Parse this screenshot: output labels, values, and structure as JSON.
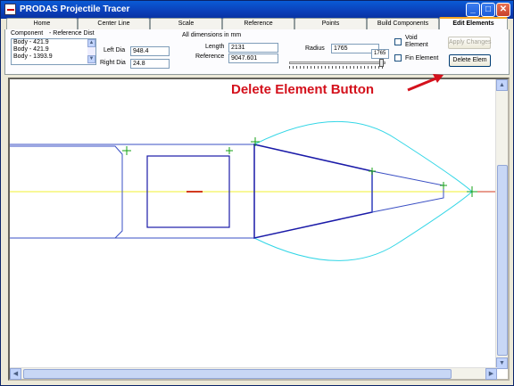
{
  "window": {
    "title": "PRODAS Projectile Tracer"
  },
  "tabs": [
    {
      "label": "Home"
    },
    {
      "label": "Center Line"
    },
    {
      "label": "Scale"
    },
    {
      "label": "Reference"
    },
    {
      "label": "Points"
    },
    {
      "label": "Build Components"
    },
    {
      "label": "Edit Elements"
    }
  ],
  "panel": {
    "component_header": "Component",
    "refdist_header": "- Reference Dist",
    "components": [
      "Body - 421.9",
      "Body - 421.9",
      "Body - 1393.9"
    ],
    "left_dia_label": "Left Dia",
    "left_dia_value": "948.4",
    "right_dia_label": "Right Dia",
    "right_dia_value": "24.8",
    "dims_note": "All dimensions in mm",
    "length_label": "Length",
    "length_value": "2131",
    "reference_label": "Reference",
    "reference_value": "9047.601",
    "radius_label": "Radius",
    "radius_value": "1765",
    "radius_readout": "1765",
    "void_label_1": "Void",
    "void_label_2": "Element",
    "fin_label": "Fin Element",
    "apply_label": "Apply Changes",
    "delete_label": "Delete Elem"
  },
  "annotation": {
    "text": "Delete Element Button",
    "color": "#d4111c"
  },
  "colors": {
    "titlebar": "#0b3fb8",
    "outline_blue": "#3a4fc4",
    "cone_dark_blue": "#1a1aa8",
    "ogive_cyan": "#33d6e6",
    "centerline_yellow": "#f2f232",
    "marker_green": "#14a014",
    "axis_red": "#d23a1e"
  }
}
